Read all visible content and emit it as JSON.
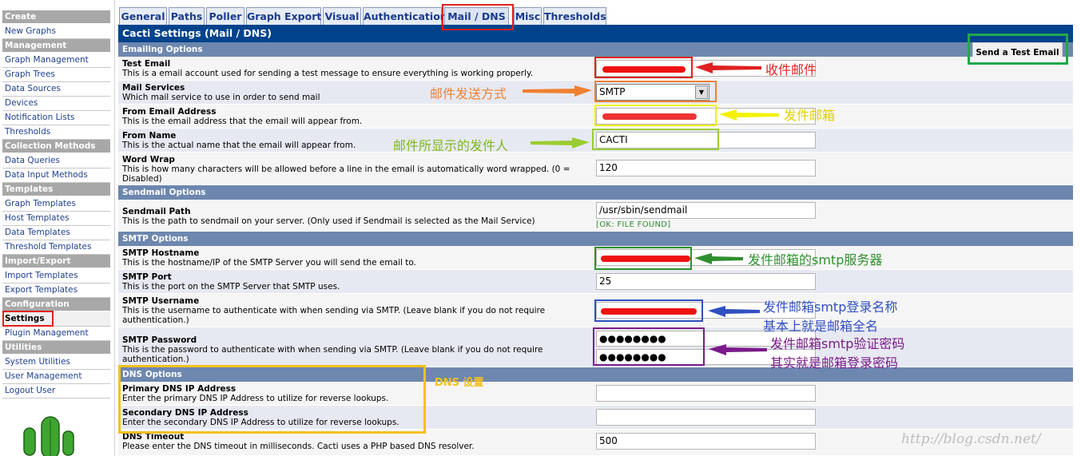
{
  "sidebar": {
    "sections": [
      {
        "title": "Create",
        "items": [
          "New Graphs"
        ]
      },
      {
        "title": "Management",
        "items": [
          "Graph Management",
          "Graph Trees",
          "Data Sources",
          "Devices",
          "Notification Lists",
          "Thresholds"
        ]
      },
      {
        "title": "Collection Methods",
        "items": [
          "Data Queries",
          "Data Input Methods"
        ]
      },
      {
        "title": "Templates",
        "items": [
          "Graph Templates",
          "Host Templates",
          "Data Templates",
          "Threshold Templates"
        ]
      },
      {
        "title": "Import/Export",
        "items": [
          "Import Templates",
          "Export Templates"
        ]
      },
      {
        "title": "Configuration",
        "items": [
          "Settings",
          "Plugin Management"
        ]
      },
      {
        "title": "Utilities",
        "items": [
          "System Utilities",
          "User Management",
          "Logout User"
        ]
      }
    ],
    "active_item": "Settings"
  },
  "tabs": [
    "General",
    "Paths",
    "Poller",
    "Graph Export",
    "Visual",
    "Authentication",
    "Mail / DNS",
    "Misc",
    "Thresholds"
  ],
  "active_tab": "Mail / DNS",
  "page_title": "Cacti Settings (Mail / DNS)",
  "test_email_button": "Send a Test Email",
  "sections": {
    "emailing": "Emailing Options",
    "sendmail": "Sendmail Options",
    "smtp": "SMTP Options",
    "dns": "DNS Options"
  },
  "fields": {
    "test_email": {
      "label": "Test Email",
      "desc": "This is a email account used for sending a test message to ensure everything is working properly.",
      "value": ""
    },
    "mail_services": {
      "label": "Mail Services",
      "desc": "Which mail service to use in order to send mail",
      "value": "SMTP"
    },
    "from_email": {
      "label": "From Email Address",
      "desc": "This is the email address that the email will appear from.",
      "value": ""
    },
    "from_name": {
      "label": "From Name",
      "desc": "This is the actual name that the email will appear from.",
      "value": "CACTI"
    },
    "word_wrap": {
      "label": "Word Wrap",
      "desc": "This is how many characters will be allowed before a line in the email is automatically word wrapped. (0 = Disabled)",
      "value": "120"
    },
    "sendmail_path": {
      "label": "Sendmail Path",
      "desc": "This is the path to sendmail on your server. (Only used if Sendmail is selected as the Mail Service)",
      "value": "/usr/sbin/sendmail",
      "status": "[OK: FILE FOUND]"
    },
    "smtp_hostname": {
      "label": "SMTP Hostname",
      "desc": "This is the hostname/IP of the SMTP Server you will send the email to.",
      "value": ""
    },
    "smtp_port": {
      "label": "SMTP Port",
      "desc": "This is the port on the SMTP Server that SMTP uses.",
      "value": "25"
    },
    "smtp_username": {
      "label": "SMTP Username",
      "desc": "This is the username to authenticate with when sending via SMTP. (Leave blank if you do not require authentication.)",
      "value": ""
    },
    "smtp_password": {
      "label": "SMTP Password",
      "desc": "This is the password to authenticate with when sending via SMTP. (Leave blank if you do not require authentication.)",
      "value": "●●●●●●●●",
      "confirm": "●●●●●●●●"
    },
    "dns_primary": {
      "label": "Primary DNS IP Address",
      "desc": "Enter the primary DNS IP Address to utilize for reverse lookups.",
      "value": ""
    },
    "dns_secondary": {
      "label": "Secondary DNS IP Address",
      "desc": "Enter the secondary DNS IP Address to utilize for reverse lookups.",
      "value": ""
    },
    "dns_timeout": {
      "label": "DNS Timeout",
      "desc": "Please enter the DNS timeout in milliseconds. Cacti uses a PHP based DNS resolver.",
      "value": "500"
    }
  },
  "annotations": {
    "test_email": "收件邮件",
    "mail_services": "邮件发送方式",
    "from_email": "发件邮箱",
    "from_name": "邮件所显示的发件人",
    "smtp_hostname": "发件邮箱的smtp服务器",
    "smtp_username_1": "发件邮箱smtp登录名称",
    "smtp_username_2": "基本上就是邮箱全名",
    "smtp_password_1": "发件邮箱smtp验证密码",
    "smtp_password_2": "其实就是邮箱登录密码",
    "dns": "DNS 设置"
  },
  "annotation_colors": {
    "red": "#e02020",
    "orange": "#ef8030",
    "yellow": "#f2f200",
    "green_light": "#9acd32",
    "green_dark": "#2f8f2f",
    "blue": "#3050c0",
    "purple": "#7a1a8a",
    "gold": "#f4c020",
    "green_btn": "#22a84a"
  },
  "watermark": "http://blog.csdn.net/"
}
